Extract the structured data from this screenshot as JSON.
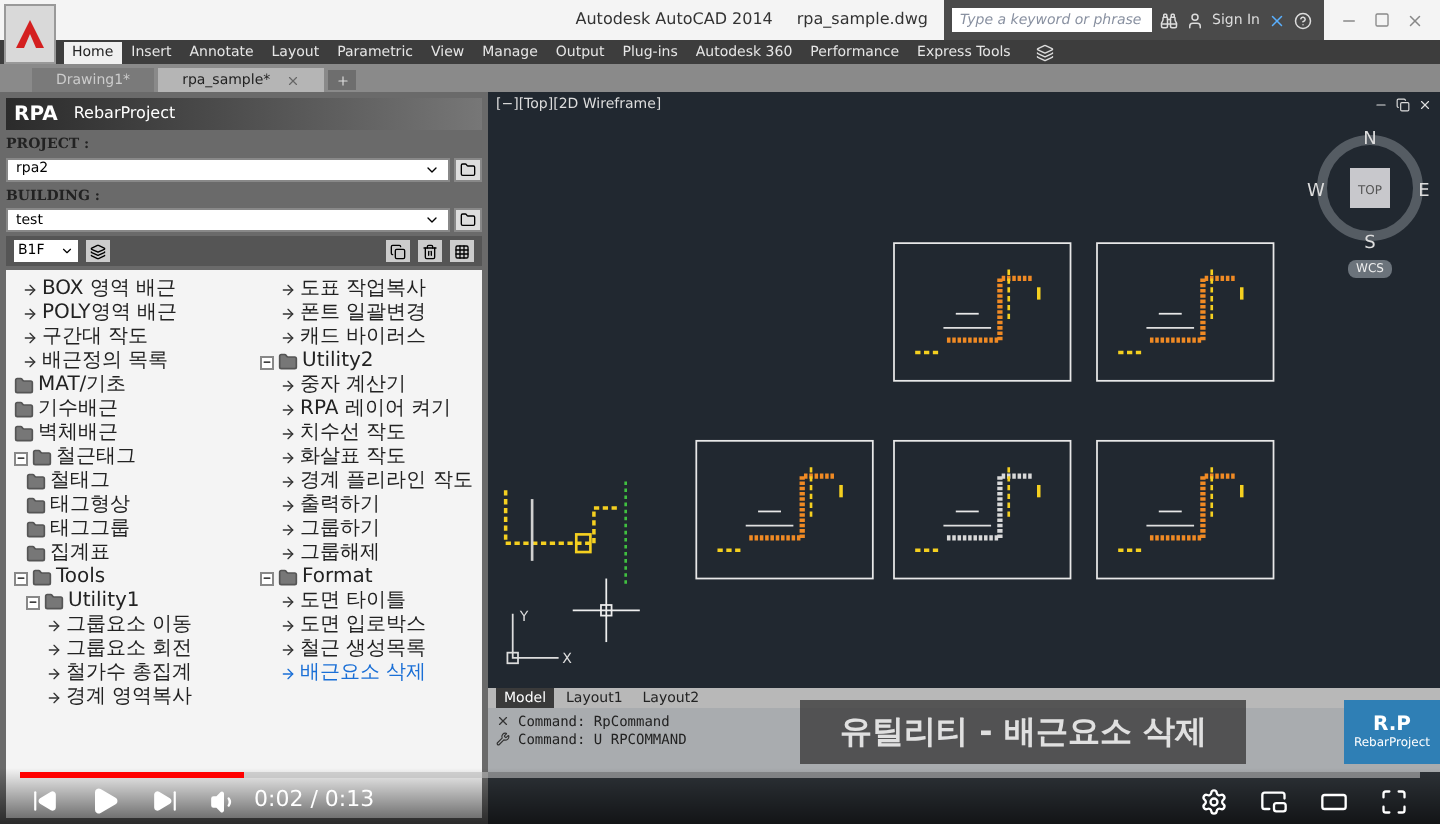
{
  "title_bar": {
    "app": "Autodesk AutoCAD 2014",
    "file": "rpa_sample.dwg",
    "search": {
      "placeholder": "Type a keyword or phrase"
    },
    "sign_in": "Sign In"
  },
  "ribbon_tabs": [
    {
      "label": "Home",
      "selected": true
    },
    {
      "label": "Insert",
      "selected": false
    },
    {
      "label": "Annotate",
      "selected": false
    },
    {
      "label": "Layout",
      "selected": false
    },
    {
      "label": "Parametric",
      "selected": false
    },
    {
      "label": "View",
      "selected": false
    },
    {
      "label": "Manage",
      "selected": false
    },
    {
      "label": "Output",
      "selected": false
    },
    {
      "label": "Plug-ins",
      "selected": false
    },
    {
      "label": "Autodesk 360",
      "selected": false
    },
    {
      "label": "Performance",
      "selected": false
    },
    {
      "label": "Express Tools",
      "selected": false
    }
  ],
  "doc_tabs": [
    {
      "label": "Drawing1*",
      "selected": false
    },
    {
      "label": "rpa_sample*",
      "selected": true
    }
  ],
  "panel": {
    "logo": "RPA",
    "title": "RebarProject",
    "project": {
      "label": "PROJECT :",
      "value": "rpa2"
    },
    "building": {
      "label": "BUILDING :",
      "value": "test"
    },
    "floor": "B1F",
    "tree": [
      {
        "label": "BOX 영역 배근",
        "kind": "command",
        "selected": false
      },
      {
        "label": "POLY영역 배근",
        "kind": "command",
        "selected": false
      },
      {
        "label": "구간대 작도",
        "kind": "command",
        "selected": false
      },
      {
        "label": "배근정의 목록",
        "kind": "command",
        "selected": false
      },
      {
        "label": "MAT/기초",
        "kind": "folder",
        "selected": false
      },
      {
        "label": "기수배근",
        "kind": "folder",
        "selected": false
      },
      {
        "label": "벽체배근",
        "kind": "folder",
        "selected": false
      },
      {
        "label": "철근태그",
        "kind": "folder",
        "selected": false,
        "expanded": true,
        "children": [
          {
            "label": "철태그",
            "kind": "folder",
            "selected": false
          },
          {
            "label": "태그형상",
            "kind": "folder",
            "selected": false
          },
          {
            "label": "태그그룹",
            "kind": "folder",
            "selected": false
          },
          {
            "label": "집계표",
            "kind": "folder",
            "selected": false
          }
        ]
      },
      {
        "label": "Tools",
        "kind": "folder",
        "selected": false,
        "expanded": true,
        "children": [
          {
            "label": "Utility1",
            "kind": "folder",
            "selected": false,
            "expanded": true,
            "children": [
              {
                "label": "그룹요소 이동",
                "kind": "command",
                "selected": false
              },
              {
                "label": "그룹요소 회전",
                "kind": "command",
                "selected": false
              },
              {
                "label": "철가수 총집계",
                "kind": "command",
                "selected": false
              },
              {
                "label": "경계 영역복사",
                "kind": "command",
                "selected": false
              },
              {
                "label": "도표 작업복사",
                "kind": "command",
                "selected": false
              },
              {
                "label": "폰트 일괄변경",
                "kind": "command",
                "selected": false
              },
              {
                "label": "캐드 바이러스",
                "kind": "command",
                "selected": false
              }
            ]
          },
          {
            "label": "Utility2",
            "kind": "folder",
            "selected": false,
            "expanded": true,
            "children": [
              {
                "label": "중자 계산기",
                "kind": "command",
                "selected": false
              },
              {
                "label": "RPA 레이어 켜기",
                "kind": "command",
                "selected": false
              },
              {
                "label": "치수선 작도",
                "kind": "command",
                "selected": false
              },
              {
                "label": "화살표 작도",
                "kind": "command",
                "selected": false
              },
              {
                "label": "경계 플리라인 작도",
                "kind": "command",
                "selected": false
              },
              {
                "label": "출력하기",
                "kind": "command",
                "selected": false
              },
              {
                "label": "그룹하기",
                "kind": "command",
                "selected": false
              },
              {
                "label": "그룹해제",
                "kind": "command",
                "selected": false
              }
            ]
          },
          {
            "label": "Format",
            "kind": "folder",
            "selected": false,
            "expanded": true,
            "children": [
              {
                "label": "도면 타이틀",
                "kind": "command",
                "selected": false
              },
              {
                "label": "도면 입로박스",
                "kind": "command",
                "selected": false
              },
              {
                "label": "철근 생성목록",
                "kind": "command",
                "selected": false
              },
              {
                "label": "배근요소 삭제",
                "kind": "command",
                "selected": true
              }
            ]
          }
        ]
      }
    ]
  },
  "viewport": {
    "label": "[−][Top][2D Wireframe]",
    "compass": {
      "n": "N",
      "w": "W",
      "e": "E",
      "s": "S",
      "top": "TOP"
    },
    "ucs_name": "WCS",
    "axes": {
      "x": "X",
      "y": "Y"
    }
  },
  "layout_tabs": [
    {
      "label": "Model",
      "selected": true
    },
    {
      "label": "Layout1",
      "selected": false
    },
    {
      "label": "Layout2",
      "selected": false
    }
  ],
  "command_lines": [
    "Command: RpCommand",
    "Command: U RPCOMMAND"
  ],
  "video": {
    "caption": "유틸리티 - 배근요소 삭제",
    "channel_logo": "R.P",
    "channel_name": "RebarProject",
    "progress": {
      "level": 0.16
    },
    "time": "0:02 / 0:13"
  }
}
